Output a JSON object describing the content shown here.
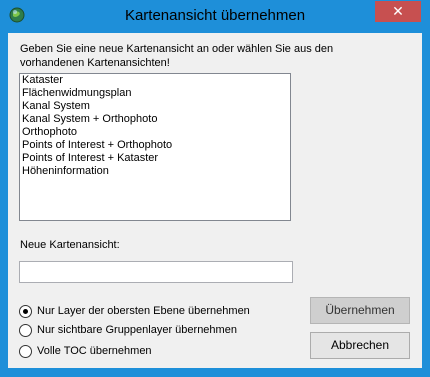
{
  "window": {
    "title": "Kartenansicht übernehmen",
    "close_label": "✕"
  },
  "prompt": {
    "line1": "Geben Sie eine neue Kartenansicht an oder wählen Sie aus den",
    "line2": "vorhandenen Kartenansichten!"
  },
  "views": {
    "items": [
      "Kataster",
      "Flächenwidmungsplan",
      "Kanal System",
      "Kanal System + Orthophoto",
      "Orthophoto",
      "Points of Interest + Orthophoto",
      "Points of Interest + Kataster",
      "Höheninformation"
    ]
  },
  "new_view": {
    "label": "Neue Kartenansicht:",
    "value": ""
  },
  "options": {
    "items": [
      {
        "label": "Nur Layer der obersten Ebene übernehmen",
        "selected": true
      },
      {
        "label": "Nur sichtbare Gruppenlayer übernehmen",
        "selected": false
      },
      {
        "label": "Volle TOC übernehmen",
        "selected": false
      }
    ]
  },
  "buttons": {
    "accept": "Übernehmen",
    "cancel": "Abbrechen"
  },
  "colors": {
    "title_bar": "#1e8fd9",
    "close_button": "#c75050",
    "client": "#f0f0f0"
  }
}
